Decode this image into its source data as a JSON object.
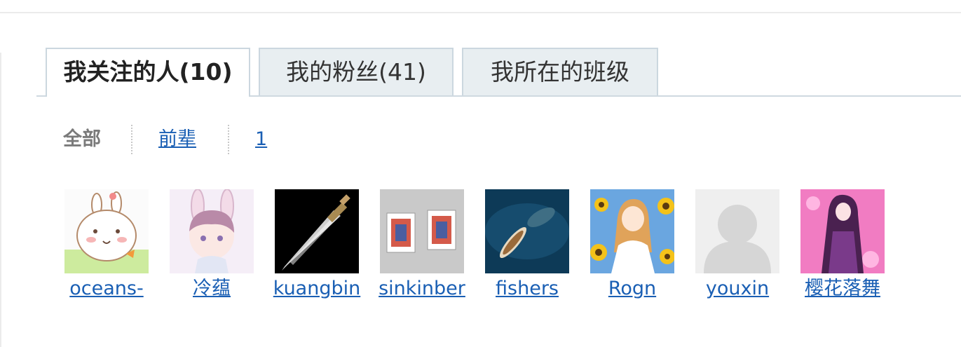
{
  "tabs": {
    "following": "我关注的人(10)",
    "fans": "我的粉丝(41)",
    "classes": "我所在的班级"
  },
  "filter": {
    "all": "全部",
    "seniors": "前辈",
    "page": "1"
  },
  "users": [
    {
      "name": "oceans-",
      "avatar": "bunny-cartoon-avatar"
    },
    {
      "name": "冷蕴",
      "avatar": "bunny-boy-avatar"
    },
    {
      "name": "kuangbin",
      "avatar": "sword-avatar"
    },
    {
      "name": "sinkinber",
      "avatar": "playing-cards-avatar"
    },
    {
      "name": "fishers",
      "avatar": "boat-whale-avatar"
    },
    {
      "name": "Rogn",
      "avatar": "sunflower-girl-avatar"
    },
    {
      "name": "youxin",
      "avatar": "default-user-avatar"
    },
    {
      "name": "樱花落舞",
      "avatar": "purple-anime-avatar"
    }
  ],
  "colors": {
    "link": "#1a5fb4",
    "tab_inactive_bg": "#e8eef1",
    "tab_border": "#cbd7df"
  }
}
